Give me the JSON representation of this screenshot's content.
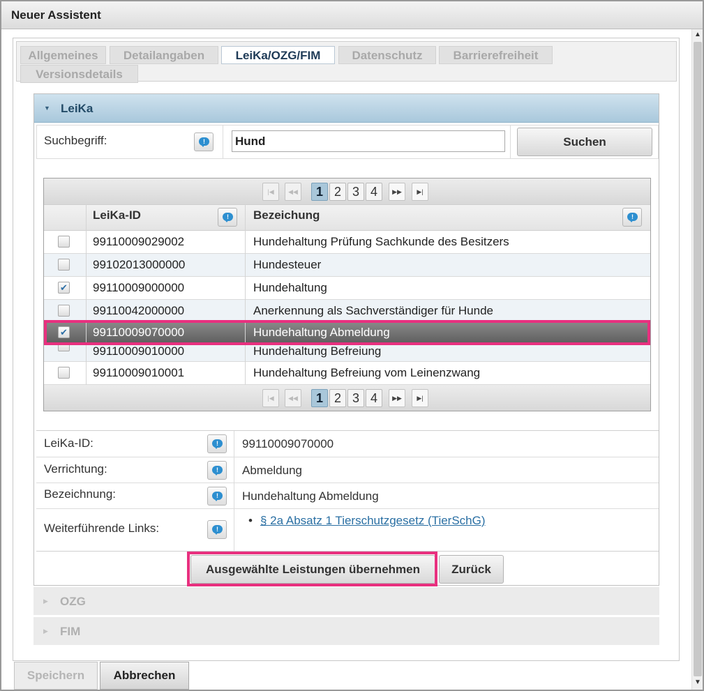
{
  "window": {
    "title": "Neuer Assistent"
  },
  "tabs": [
    {
      "label": "Allgemeines",
      "active": false
    },
    {
      "label": "Detailangaben",
      "active": false
    },
    {
      "label": "LeiKa/OZG/FIM",
      "active": true
    },
    {
      "label": "Datenschutz",
      "active": false
    },
    {
      "label": "Barrierefreiheit",
      "active": false
    },
    {
      "label": "Versionsdetails",
      "active": false
    }
  ],
  "leika": {
    "header": "LeiKa",
    "search": {
      "label": "Suchbegriff:",
      "value": "Hund",
      "button": "Suchen"
    },
    "pager": {
      "pages": [
        "1",
        "2",
        "3",
        "4"
      ],
      "current": "1"
    },
    "columns": {
      "id": "LeiKa-ID",
      "name": "Bezeichung"
    },
    "rows": [
      {
        "id": "99110009029002",
        "name": "Hundehaltung Prüfung Sachkunde des Besitzers",
        "checked": false,
        "selected": false
      },
      {
        "id": "99102013000000",
        "name": "Hundesteuer",
        "checked": false,
        "selected": false
      },
      {
        "id": "99110009000000",
        "name": "Hundehaltung",
        "checked": true,
        "selected": false
      },
      {
        "id": "99110042000000",
        "name": "Anerkennung als Sachverständiger für Hunde",
        "checked": false,
        "selected": false
      },
      {
        "id": "99110009070000",
        "name": "Hundehaltung Abmeldung",
        "checked": true,
        "selected": true
      },
      {
        "id": "99110009010000",
        "name": "Hundehaltung Befreiung",
        "checked": false,
        "selected": false
      },
      {
        "id": "99110009010001",
        "name": "Hundehaltung Befreiung vom Leinenzwang",
        "checked": false,
        "selected": false
      }
    ],
    "detail": {
      "id_label": "LeiKa-ID:",
      "id_value": "99110009070000",
      "verrichtung_label": "Verrichtung:",
      "verrichtung_value": "Abmeldung",
      "bezeichnung_label": "Bezeichnung:",
      "bezeichnung_value": "Hundehaltung Abmeldung",
      "links_label": "Weiterführende Links:",
      "link_text": "§ 2a Absatz 1 Tierschutzgesetz (TierSchG)"
    },
    "actions": {
      "apply": "Ausgewählte Leistungen übernehmen",
      "back": "Zurück"
    }
  },
  "accordions": {
    "ozg": "OZG",
    "fim": "FIM"
  },
  "footer": {
    "save": "Speichern",
    "cancel": "Abbrechen"
  },
  "colors": {
    "highlight": "#e8307f",
    "header_blue": "#a9c8dc",
    "link": "#2a6fa3"
  },
  "icons": {
    "info": "info-speech-bubble-icon",
    "checkbox": "checkbox-icon"
  }
}
